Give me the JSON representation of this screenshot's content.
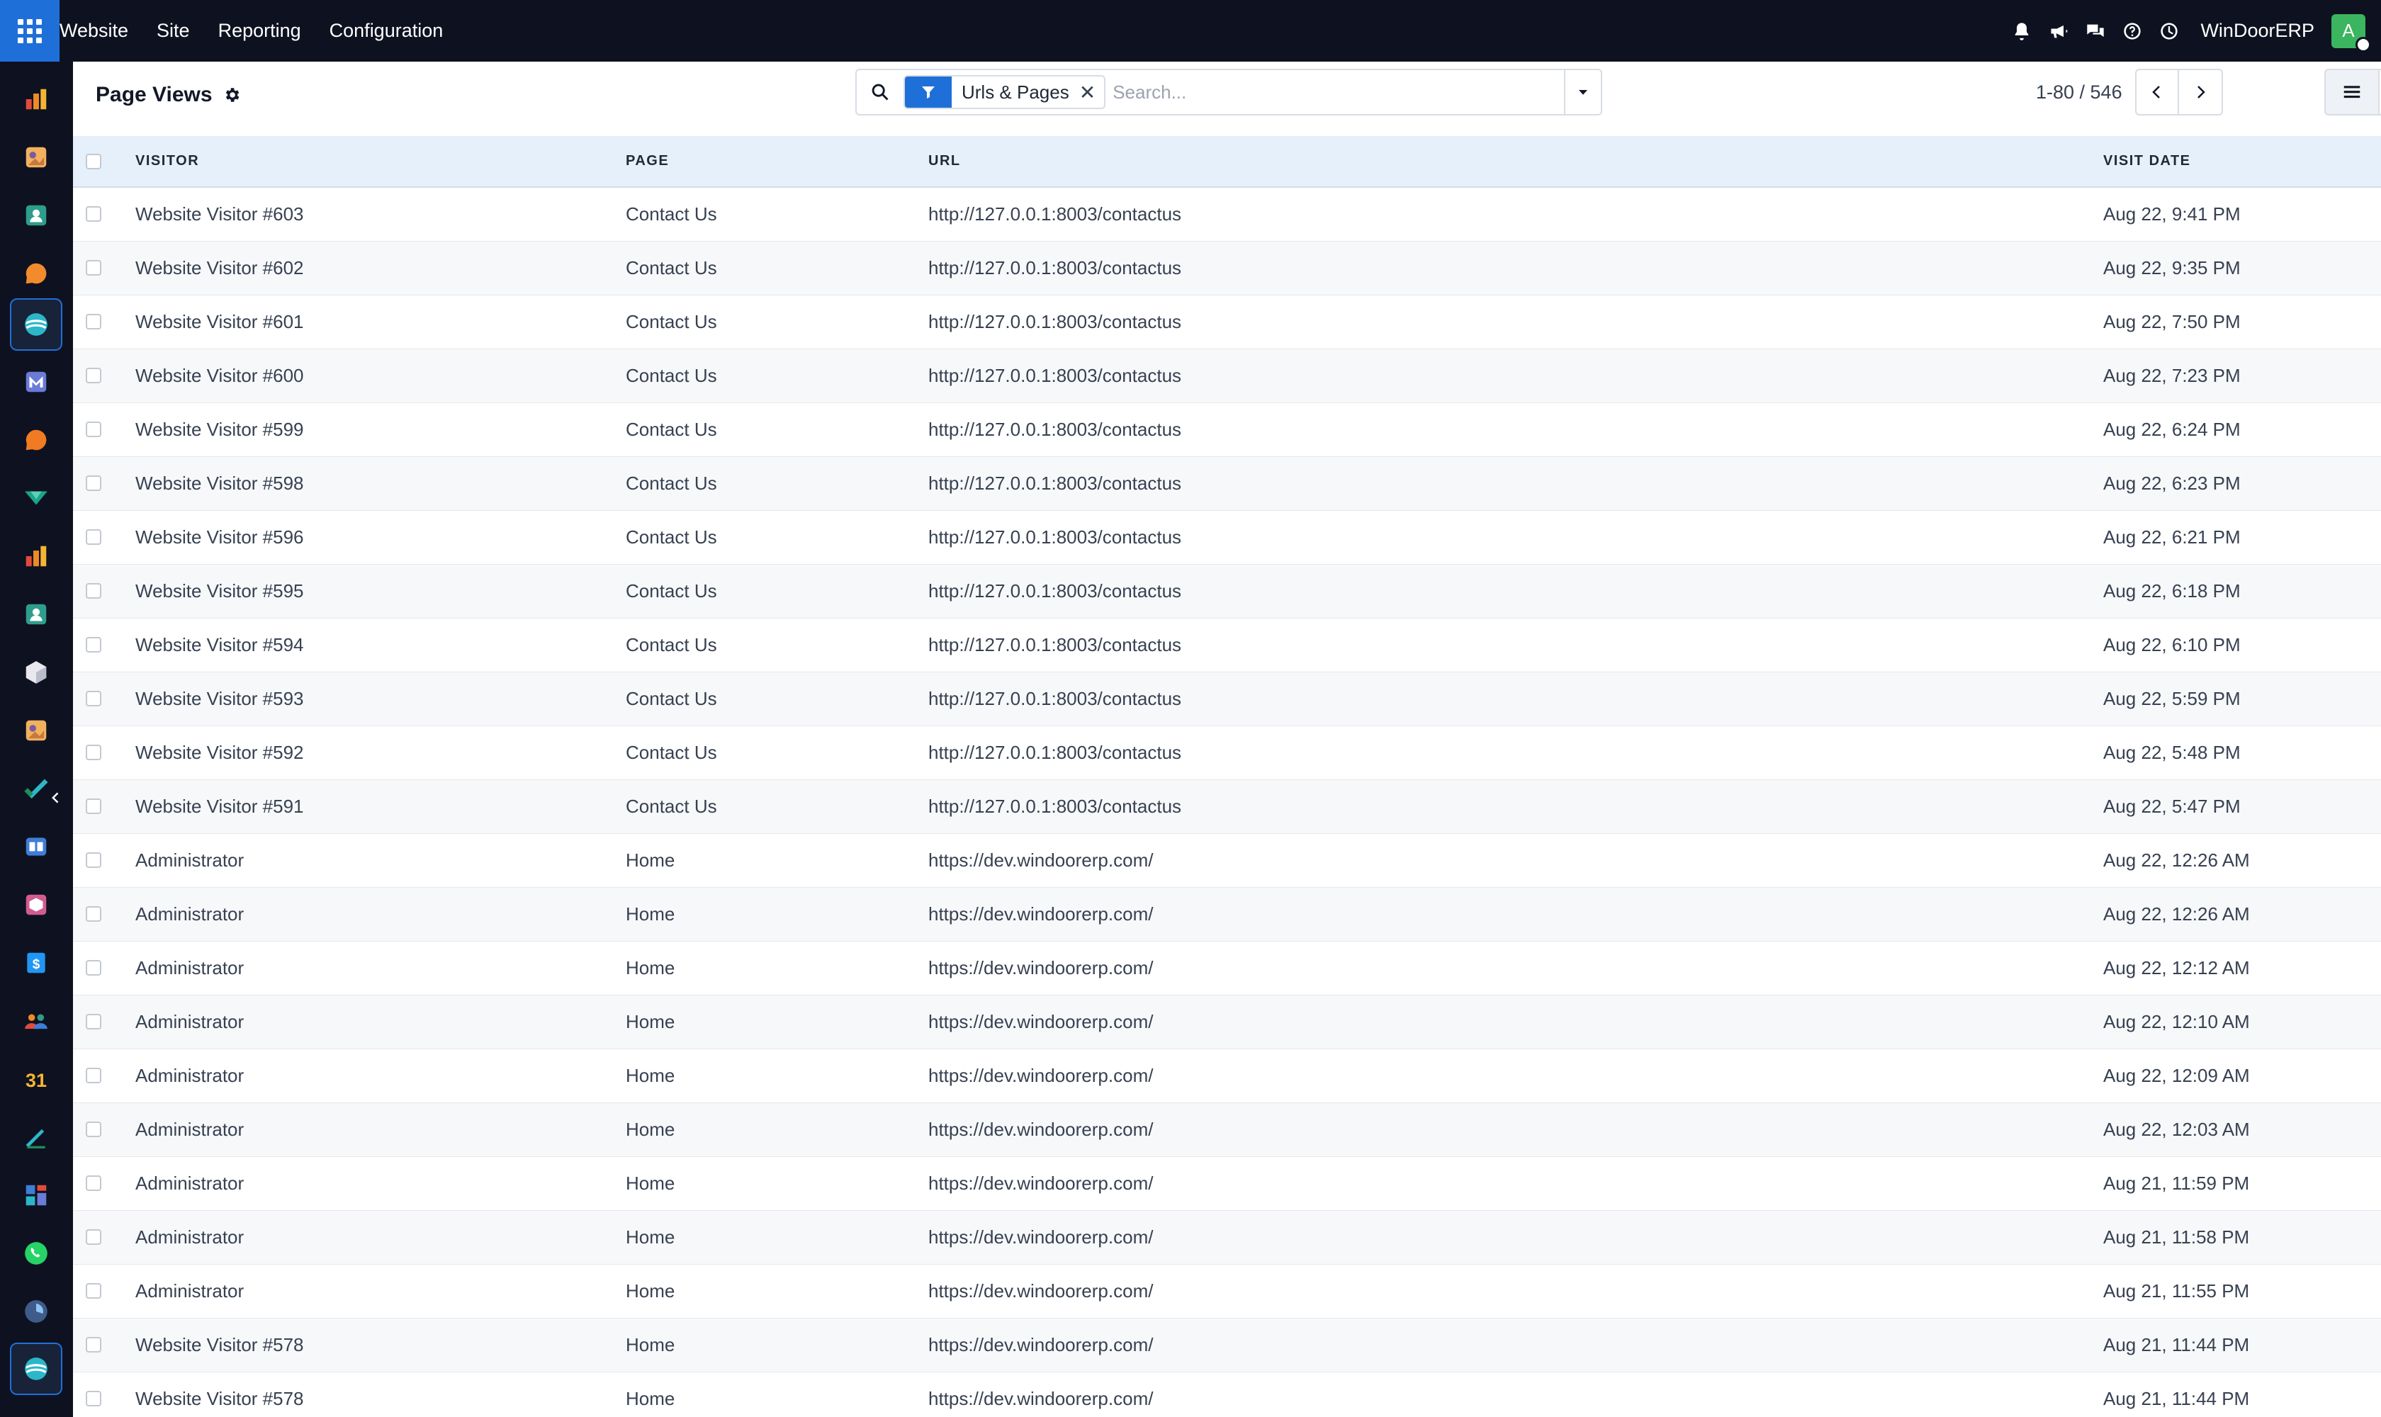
{
  "topnav": {
    "app_name": "Website",
    "menu": [
      "Site",
      "Reporting",
      "Configuration"
    ],
    "company": "WinDoorERP",
    "avatar_letter": "A"
  },
  "control": {
    "title": "Page Views",
    "facet_label": "Urls & Pages",
    "search_placeholder": "Search...",
    "pager_value": "1-80 / 546"
  },
  "table": {
    "headers": [
      "VISITOR",
      "PAGE",
      "URL",
      "VISIT DATE"
    ],
    "rows": [
      [
        "Website Visitor #603",
        "Contact Us",
        "http://127.0.0.1:8003/contactus",
        "Aug 22, 9:41 PM"
      ],
      [
        "Website Visitor #602",
        "Contact Us",
        "http://127.0.0.1:8003/contactus",
        "Aug 22, 9:35 PM"
      ],
      [
        "Website Visitor #601",
        "Contact Us",
        "http://127.0.0.1:8003/contactus",
        "Aug 22, 7:50 PM"
      ],
      [
        "Website Visitor #600",
        "Contact Us",
        "http://127.0.0.1:8003/contactus",
        "Aug 22, 7:23 PM"
      ],
      [
        "Website Visitor #599",
        "Contact Us",
        "http://127.0.0.1:8003/contactus",
        "Aug 22, 6:24 PM"
      ],
      [
        "Website Visitor #598",
        "Contact Us",
        "http://127.0.0.1:8003/contactus",
        "Aug 22, 6:23 PM"
      ],
      [
        "Website Visitor #596",
        "Contact Us",
        "http://127.0.0.1:8003/contactus",
        "Aug 22, 6:21 PM"
      ],
      [
        "Website Visitor #595",
        "Contact Us",
        "http://127.0.0.1:8003/contactus",
        "Aug 22, 6:18 PM"
      ],
      [
        "Website Visitor #594",
        "Contact Us",
        "http://127.0.0.1:8003/contactus",
        "Aug 22, 6:10 PM"
      ],
      [
        "Website Visitor #593",
        "Contact Us",
        "http://127.0.0.1:8003/contactus",
        "Aug 22, 5:59 PM"
      ],
      [
        "Website Visitor #592",
        "Contact Us",
        "http://127.0.0.1:8003/contactus",
        "Aug 22, 5:48 PM"
      ],
      [
        "Website Visitor #591",
        "Contact Us",
        "http://127.0.0.1:8003/contactus",
        "Aug 22, 5:47 PM"
      ],
      [
        "Administrator",
        "Home",
        "https://dev.windoorerp.com/",
        "Aug 22, 12:26 AM"
      ],
      [
        "Administrator",
        "Home",
        "https://dev.windoorerp.com/",
        "Aug 22, 12:26 AM"
      ],
      [
        "Administrator",
        "Home",
        "https://dev.windoorerp.com/",
        "Aug 22, 12:12 AM"
      ],
      [
        "Administrator",
        "Home",
        "https://dev.windoorerp.com/",
        "Aug 22, 12:10 AM"
      ],
      [
        "Administrator",
        "Home",
        "https://dev.windoorerp.com/",
        "Aug 22, 12:09 AM"
      ],
      [
        "Administrator",
        "Home",
        "https://dev.windoorerp.com/",
        "Aug 22, 12:03 AM"
      ],
      [
        "Administrator",
        "Home",
        "https://dev.windoorerp.com/",
        "Aug 21, 11:59 PM"
      ],
      [
        "Administrator",
        "Home",
        "https://dev.windoorerp.com/",
        "Aug 21, 11:58 PM"
      ],
      [
        "Administrator",
        "Home",
        "https://dev.windoorerp.com/",
        "Aug 21, 11:55 PM"
      ],
      [
        "Website Visitor #578",
        "Home",
        "https://dev.windoorerp.com/",
        "Aug 21, 11:44 PM"
      ],
      [
        "Website Visitor #578",
        "Home",
        "https://dev.windoorerp.com/",
        "Aug 21, 11:44 PM"
      ]
    ]
  },
  "sidebar_apps": [
    "dashboards-icon",
    "studio-icon",
    "contacts-icon",
    "discuss-icon",
    "website-icon",
    "email-marketing-icon",
    "live-chat-icon",
    "crm-icon",
    "reporting-icon",
    "employees-icon",
    "inventory-icon",
    "appraisal-icon",
    "project-icon",
    "knowledge-icon",
    "products-icon",
    "invoicing-icon",
    "members-icon",
    "calendar-icon",
    "sign-icon",
    "dashboard-grid-icon",
    "whatsapp-icon",
    "timesheet-icon",
    "website-active-icon"
  ],
  "colors": {
    "topbar": "#0e1220",
    "accent": "#1f6fd8",
    "header_row": "#e6f0fb",
    "avatar": "#3bb55f"
  }
}
